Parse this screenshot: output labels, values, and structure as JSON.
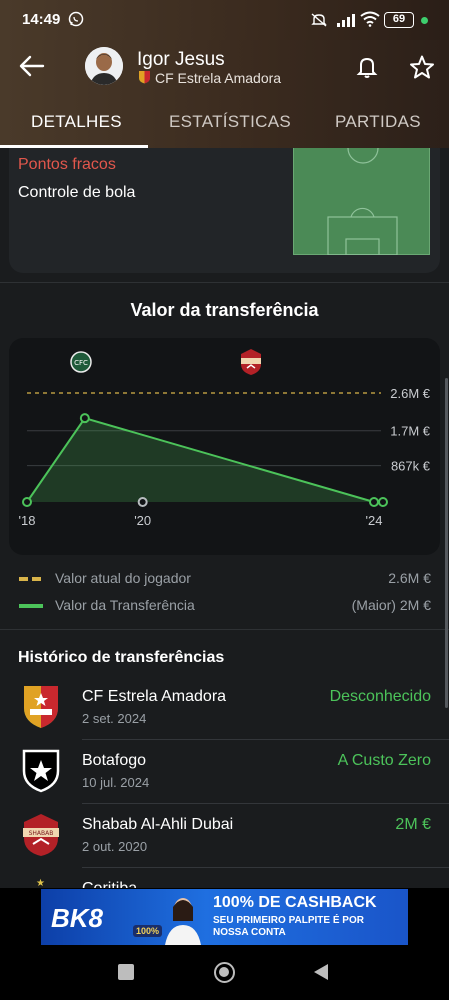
{
  "status_bar": {
    "time": "14:49",
    "battery": "69"
  },
  "header": {
    "player_name": "Igor Jesus",
    "club_name": "CF Estrela Amadora"
  },
  "tabs": [
    {
      "label": "DETALHES",
      "active": true
    },
    {
      "label": "ESTATÍSTICAS",
      "active": false
    },
    {
      "label": "PARTIDAS",
      "active": false
    }
  ],
  "weaknesses": {
    "title": "Pontos fracos",
    "item": "Controle de bola"
  },
  "transfer_value": {
    "title": "Valor da transferência",
    "chart_data": {
      "type": "line",
      "x_ticks": [
        "'18",
        "'20",
        "'24"
      ],
      "y_ticks": [
        "2.6M €",
        "1.7M €",
        "867k €"
      ],
      "current_value_line": 2.6,
      "series": [
        {
          "name": "Valor da Transferência",
          "points": [
            {
              "x": "'18",
              "y": 0
            },
            {
              "x": "'19",
              "y": 2.0
            },
            {
              "x": "'24",
              "y": 0
            }
          ]
        }
      ],
      "clubs_marked": [
        "Coritiba",
        "Shabab Al-Ahli Dubai"
      ]
    },
    "legend": [
      {
        "label": "Valor atual do jogador",
        "value": "2.6M €",
        "color": "#d9b44a",
        "style": "dashed"
      },
      {
        "label": "Valor da Transferência",
        "value": "(Maior) 2M €",
        "color": "#4cc35a",
        "style": "solid"
      }
    ]
  },
  "history": {
    "title": "Histórico de transferências",
    "items": [
      {
        "club": "CF Estrela Amadora",
        "date": "2 set. 2024",
        "fee": "Desconhecido",
        "icon": "estrela-amadora-crest-icon"
      },
      {
        "club": "Botafogo",
        "date": "10 jul. 2024",
        "fee": "A Custo Zero",
        "icon": "botafogo-crest-icon"
      },
      {
        "club": "Shabab Al-Ahli Dubai",
        "date": "2 out. 2020",
        "fee": "2M €",
        "icon": "shabab-al-ahli-crest-icon"
      },
      {
        "club": "Coritiba",
        "date": "",
        "fee": "",
        "icon": "coritiba-crest-icon"
      }
    ]
  },
  "ad": {
    "brand": "BK8",
    "headline": "100% DE CASHBACK",
    "subline": "SEU PRIMEIRO PALPITE É POR NOSSA CONTA",
    "badge": "100%"
  }
}
